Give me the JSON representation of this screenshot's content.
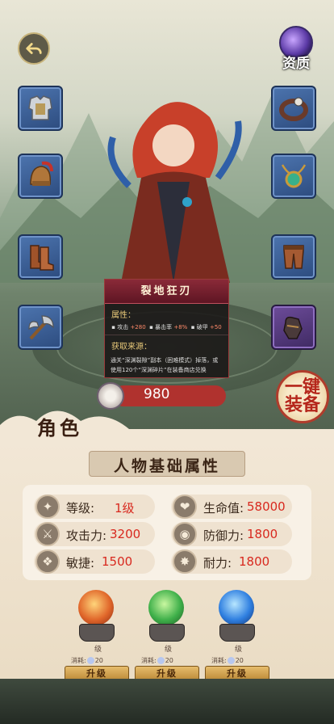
{
  "top": {
    "quality_label": "资质"
  },
  "equipment_slots": {
    "left": [
      "armor-slot",
      "helmet-slot",
      "boots-slot",
      "axe-slot"
    ],
    "right": [
      "bracelet-slot",
      "amulet-slot",
      "pants-slot",
      "gloves-slot"
    ]
  },
  "tooltip": {
    "name": "裂地狂刃",
    "attr_title": "属性：",
    "stats": [
      {
        "label": "攻击",
        "value": "+280"
      },
      {
        "label": "暴击率",
        "value": "+8%"
      },
      {
        "label": "破甲",
        "value": "+50"
      }
    ],
    "source_title": "获取来源：",
    "source_text": "通关“深渊裂隙”副本（困难模式）掉落，或使用120个“深渊碎片”在装备商店兑换"
  },
  "currency": {
    "amount": "980"
  },
  "equip_all": {
    "line1": "一键",
    "line2": "装备"
  },
  "section": {
    "role_title": "角色",
    "banner": "人物基础属性"
  },
  "attributes": [
    {
      "label": "等级:",
      "value": "1级",
      "icon": "level-icon"
    },
    {
      "label": "生命值:",
      "value": "58000",
      "icon": "heart-icon"
    },
    {
      "label": "攻击力:",
      "value": "3200",
      "icon": "attack-icon"
    },
    {
      "label": "防御力:",
      "value": "1800",
      "icon": "defense-icon"
    },
    {
      "label": "敏捷:",
      "value": "1500",
      "icon": "agility-icon"
    },
    {
      "label": "耐力:",
      "value": "1800",
      "icon": "stamina-icon"
    }
  ],
  "upgrades": [
    {
      "color": "#e0662a",
      "level_label": "级",
      "cost_label": "消耗:",
      "cost": "20",
      "button": "升级"
    },
    {
      "color": "#3fb04a",
      "level_label": "级",
      "cost_label": "消耗:",
      "cost": "20",
      "button": "升级"
    },
    {
      "color": "#2f7fe0",
      "level_label": "级",
      "cost_label": "消耗:",
      "cost": "20",
      "button": "升级"
    }
  ]
}
